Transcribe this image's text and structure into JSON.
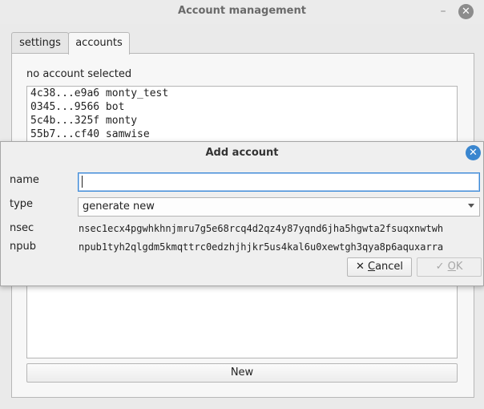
{
  "window": {
    "title": "Account management",
    "minimize_label": "–",
    "close_label": "✕"
  },
  "tabs": [
    {
      "label": "settings"
    },
    {
      "label": "accounts"
    }
  ],
  "accounts_panel": {
    "status": "no account selected",
    "accounts": [
      {
        "key": "4c38...e9a6",
        "name": "monty_test"
      },
      {
        "key": "0345...9566",
        "name": "bot"
      },
      {
        "key": "5c4b...325f",
        "name": "monty"
      },
      {
        "key": "55b7...cf40",
        "name": "samwise"
      }
    ],
    "new_button": "New"
  },
  "dialog": {
    "title": "Add account",
    "close_label": "✕",
    "name_label": "name",
    "name_value": "",
    "type_label": "type",
    "type_value": "generate new",
    "nsec_label": "nsec",
    "nsec_value": "nsec1ecx4pgwhkhnjmru7g5e68rcq4d2qz4y87yqnd6jha5hgwta2fsuqxnwtwh",
    "npub_label": "npub",
    "npub_value": "npub1tyh2qlgdm5kmqttrc0edzhjhjkr5us4kal6u0xewtgh3qya8p6aquxarra",
    "cancel_icon": "✕",
    "cancel_first": "C",
    "cancel_rest": "ancel",
    "ok_icon": "✓",
    "ok_first": "O",
    "ok_rest": "K"
  }
}
